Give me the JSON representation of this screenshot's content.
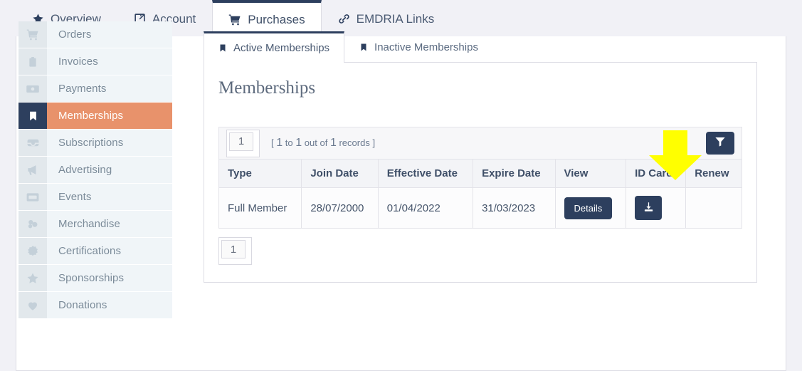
{
  "top_tabs": [
    {
      "label": "Overview",
      "icon": "star-icon",
      "active": false
    },
    {
      "label": "Account",
      "icon": "edit-square-icon",
      "active": false
    },
    {
      "label": "Purchases",
      "icon": "cart-icon",
      "active": true
    },
    {
      "label": "EMDRIA Links",
      "icon": "link-icon",
      "active": false
    }
  ],
  "sidebar": {
    "items": [
      {
        "label": "Orders",
        "icon": "cart-icon",
        "active": false
      },
      {
        "label": "Invoices",
        "icon": "clipboard-icon",
        "active": false
      },
      {
        "label": "Payments",
        "icon": "banknote-icon",
        "active": false
      },
      {
        "label": "Memberships",
        "icon": "bookmark-icon",
        "active": true
      },
      {
        "label": "Subscriptions",
        "icon": "inbox-icon",
        "active": false
      },
      {
        "label": "Advertising",
        "icon": "megaphone-icon",
        "active": false
      },
      {
        "label": "Events",
        "icon": "ticket-icon",
        "active": false
      },
      {
        "label": "Merchandise",
        "icon": "boxes-icon",
        "active": false
      },
      {
        "label": "Certifications",
        "icon": "certificate-icon",
        "active": false
      },
      {
        "label": "Sponsorships",
        "icon": "star-icon",
        "active": false
      },
      {
        "label": "Donations",
        "icon": "heart-icon",
        "active": false
      }
    ]
  },
  "sub_tabs": [
    {
      "label": "Active Memberships",
      "icon": "bookmark-icon",
      "active": true
    },
    {
      "label": "Inactive Memberships",
      "icon": "bookmark-icon",
      "active": false
    }
  ],
  "panel": {
    "title": "Memberships",
    "pager": {
      "page_value": "1",
      "records_prefix": "[",
      "records_from": "1",
      "records_to_label": "to",
      "records_to": "1",
      "records_outof_label": "out of",
      "records_total": "1",
      "records_word": "records",
      "records_suffix": "]",
      "filter_icon": "filter-icon",
      "bottom_page_value": "1"
    },
    "table": {
      "columns": [
        "Type",
        "Join Date",
        "Effective Date",
        "Expire Date",
        "View",
        "ID Card",
        "Renew"
      ],
      "rows": [
        {
          "type": "Full Member",
          "join_date": "28/07/2000",
          "effective_date": "01/04/2022",
          "expire_date": "31/03/2023",
          "view_label": "Details",
          "id_card_icon": "download-icon",
          "renew": ""
        }
      ]
    }
  },
  "annotation": {
    "type": "down-arrow",
    "color": "#ffff00"
  },
  "colors": {
    "page_bg": "#f1f1f6",
    "navy": "#2d3f5e",
    "accent_salmon": "#e8926b",
    "sidebar_bg": "#f0f5f8",
    "sidebar_icon_bg": "#e2e8ec"
  }
}
